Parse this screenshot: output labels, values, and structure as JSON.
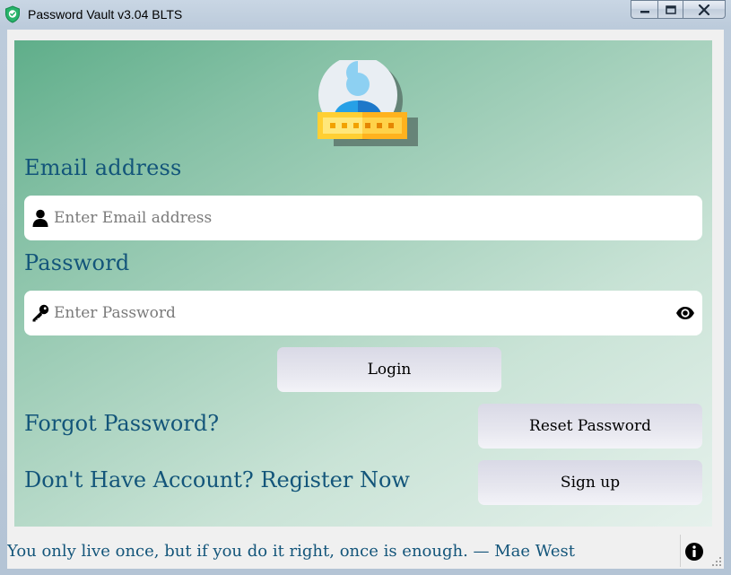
{
  "window": {
    "title": "Password Vault v3.04 BLTS",
    "minimize_glyph": "—",
    "maximize_glyph": "☐",
    "close_glyph": "✕"
  },
  "icons": {
    "app": "shield-check-icon",
    "logo": "user-password-icon",
    "email_field": "user-icon",
    "password_field": "key-icon",
    "show_password": "eye-icon",
    "info": "info-icon"
  },
  "colors": {
    "label_text": "#13557a",
    "panel_gradient_start": "#5fae8a",
    "panel_gradient_end": "#e6f1ec",
    "button_bg": "#e7e7ef"
  },
  "login_form": {
    "email_label": "Email address",
    "email_placeholder": "Enter Email address",
    "email_value": "",
    "password_label": "Password",
    "password_placeholder": "Enter Password",
    "password_value": "",
    "login_button": "Login",
    "forgot_link": "Forgot Password?",
    "reset_button": "Reset Password",
    "register_link": "Don't Have Account? Register Now",
    "signup_button": "Sign up"
  },
  "footer": {
    "quote": "You only live once, but if you do it right, once is enough. — Mae West"
  }
}
